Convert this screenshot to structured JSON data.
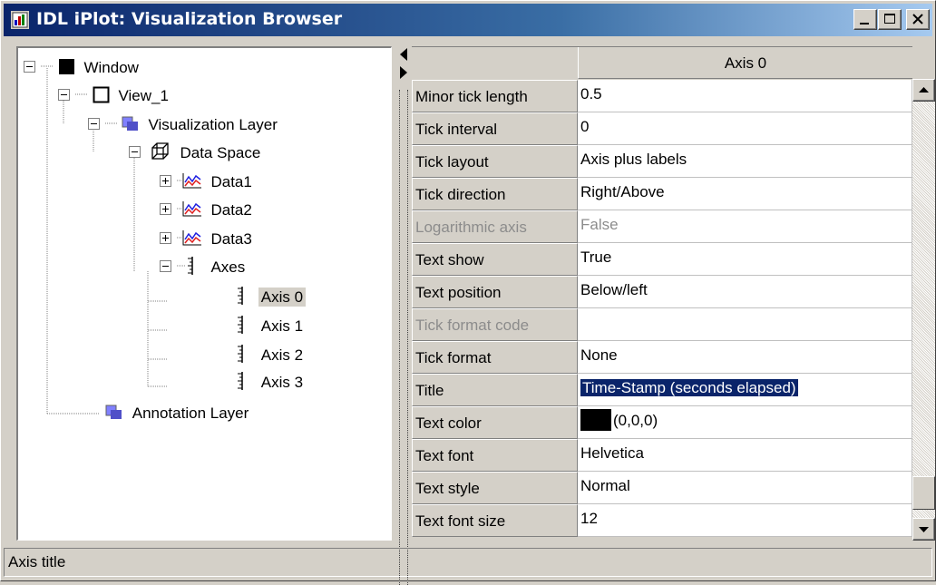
{
  "window": {
    "title": "IDL iPlot: Visualization Browser"
  },
  "tree": {
    "nodes": [
      {
        "label": "Window",
        "icon": "window-icon"
      },
      {
        "label": "View_1",
        "icon": "view-icon"
      },
      {
        "label": "Visualization Layer",
        "icon": "layer-icon"
      },
      {
        "label": "Data Space",
        "icon": "data-space-icon"
      },
      {
        "label": "Data1",
        "icon": "plot-icon"
      },
      {
        "label": "Data2",
        "icon": "plot-icon"
      },
      {
        "label": "Data3",
        "icon": "plot-icon"
      },
      {
        "label": "Axes",
        "icon": "axes-icon"
      },
      {
        "label": "Axis 0",
        "icon": "axis-icon",
        "selected": true
      },
      {
        "label": "Axis 1",
        "icon": "axis-icon"
      },
      {
        "label": "Axis 2",
        "icon": "axis-icon"
      },
      {
        "label": "Axis 3",
        "icon": "axis-icon"
      },
      {
        "label": "Annotation Layer",
        "icon": "layer-icon"
      }
    ]
  },
  "properties": {
    "column_header": "Axis 0",
    "rows": [
      {
        "name": "Minor tick length",
        "value": "0.5"
      },
      {
        "name": "Tick interval",
        "value": "0"
      },
      {
        "name": "Tick layout",
        "value": "Axis plus labels"
      },
      {
        "name": "Tick direction",
        "value": "Right/Above"
      },
      {
        "name": "Logarithmic axis",
        "value": "False",
        "disabled": true
      },
      {
        "name": "Text show",
        "value": "True"
      },
      {
        "name": "Text position",
        "value": "Below/left"
      },
      {
        "name": "Tick format code",
        "value": "",
        "disabled": true
      },
      {
        "name": "Tick format",
        "value": "None"
      },
      {
        "name": "Title",
        "value": "Time-Stamp (seconds elapsed)",
        "editing": true
      },
      {
        "name": "Text color",
        "value": "(0,0,0)",
        "swatch": "#000000"
      },
      {
        "name": "Text font",
        "value": "Helvetica"
      },
      {
        "name": "Text style",
        "value": "Normal"
      },
      {
        "name": "Text font size",
        "value": "12"
      }
    ]
  },
  "status": {
    "text": "Axis title"
  },
  "colors": {
    "titlebar_start": "#0a246a",
    "titlebar_end": "#a6caf0",
    "selection": "#0a246a",
    "face": "#d4d0c8"
  }
}
